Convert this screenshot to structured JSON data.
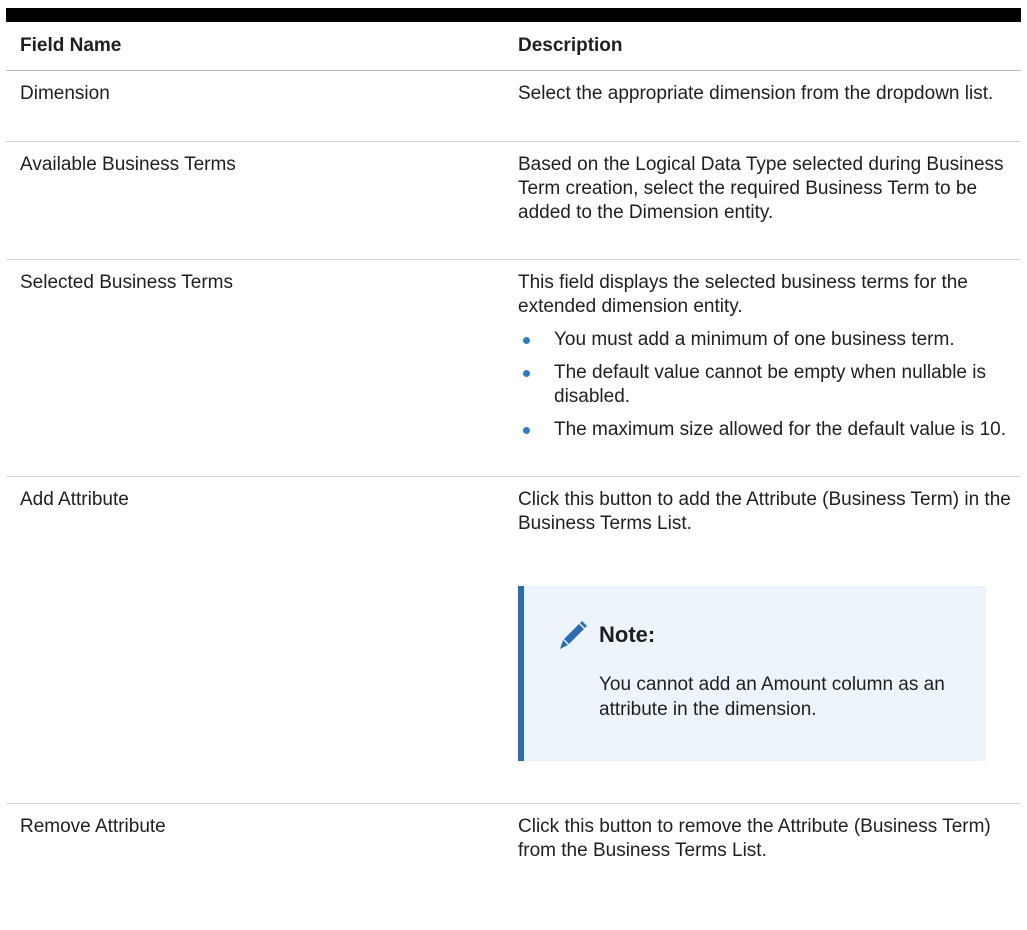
{
  "table": {
    "headers": {
      "field_name": "Field Name",
      "description": "Description"
    },
    "rows": [
      {
        "field": "Dimension",
        "description": "Select the appropriate dimension from the dropdown list."
      },
      {
        "field": "Available Business Terms",
        "description": "Based on the Logical Data Type selected during Business Term creation, select the required Business Term to be added to the Dimension entity."
      },
      {
        "field": "Selected Business Terms",
        "description": "This field displays the selected business terms for the extended dimension entity.",
        "bullets": [
          "You must add a minimum of one business term.",
          "The default value cannot be empty when nullable is disabled.",
          "The maximum size allowed for the default value is 10."
        ]
      },
      {
        "field": "Add Attribute",
        "description": "Click this button to add the Attribute (Business Term) in the Business Terms List.",
        "note": {
          "icon": "pencil-icon",
          "title": "Note:",
          "text": "You cannot add an Amount column as an attribute in the dimension."
        }
      },
      {
        "field": "Remove Attribute",
        "description": "Click this button to remove the Attribute (Business Term) from the Business Terms List."
      }
    ]
  },
  "colors": {
    "header_rule": "#000000",
    "bullet": "#2e7cc9",
    "note_border": "#2a6db4",
    "note_background": "#eef4fb"
  }
}
